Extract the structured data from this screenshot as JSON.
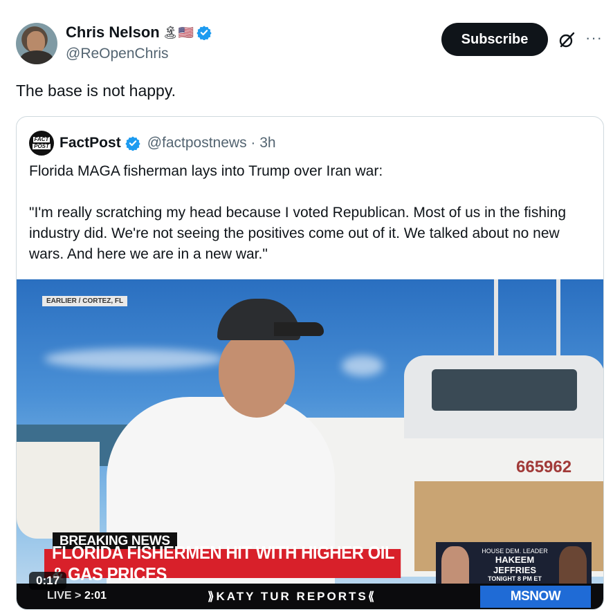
{
  "author": {
    "display_name": "Chris Nelson",
    "emojis": "🏝🇺🇸",
    "handle": "@ReOpenChris",
    "verified_color": "#1d9bf0"
  },
  "actions": {
    "subscribe_label": "Subscribe",
    "more_label": "···"
  },
  "tweet": {
    "text": "The base is not happy."
  },
  "quote": {
    "avatar_top": "FACT",
    "avatar_bottom": "POST",
    "name": "FactPost",
    "handle_time": "@factpostnews · 3h",
    "paragraph1": "Florida MAGA fisherman lays into Trump over Iran war:",
    "paragraph2": "\"I'm really scratching my head because I voted Republican. Most of us in the fishing industry did. We're not seeing the positives come out of it. We talked about no new wars. And here we are in a new war.\""
  },
  "video": {
    "location_tag": "EARLIER / CORTEZ, FL",
    "hull_number": "665962",
    "breaking_label": "BREAKING NEWS",
    "headline": "FLORIDA FISHERMEN HIT WITH HIGHER OIL & GAS PRICES",
    "promo_kicker": "HOUSE DEM. LEADER",
    "promo_name": "HAKEEM JEFFRIES",
    "promo_time": "TONIGHT 8 PM ET",
    "ticker_live": "LIVE >",
    "ticker_time": "2:01",
    "ticker_show": "⟫KATY TUR REPORTS⟪",
    "network": "MSNOW",
    "timestamp": "0:17"
  }
}
